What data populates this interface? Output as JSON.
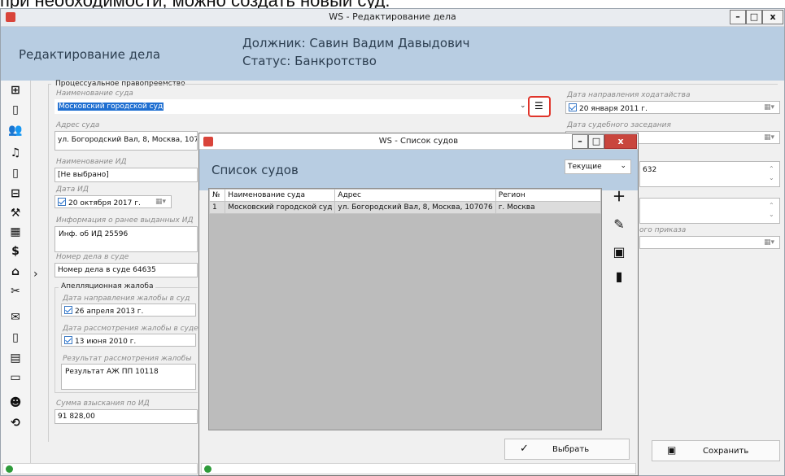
{
  "top_caption": "при необходимости, можно создать новый суд.",
  "main_window": {
    "title": "WS - Редактирование дела",
    "controls": [
      "–",
      "□",
      "x"
    ]
  },
  "header": {
    "section_title": "Редактирование дела",
    "debtor": "Должник: Савин Вадим Давыдович",
    "status": "Статус: Банкротство"
  },
  "sidebar_icons": [
    "add-document-icon",
    "document-icon",
    "users-icon",
    "bell-icon",
    "document-search-icon",
    "archive-icon",
    "gavel-icon",
    "calendar-icon",
    "dollar-icon",
    "house-search-icon",
    "tools-icon",
    "mail-icon",
    "file-refresh-icon",
    "file-text-icon",
    "chat-icon",
    "users-volume-icon",
    "history-icon"
  ],
  "form": {
    "group_title": "Процессуальное правопреемство",
    "court_name_label": "Наименование суда",
    "court_name_value": "Московский городской суд",
    "court_address_label": "Адрес суда",
    "court_address_value": "ул. Богородский Вал, 8, Москва, 107076",
    "id_name_label": "Наименование ИД",
    "id_name_value": "[Не выбрано]",
    "id_date_label": "Дата ИД",
    "id_date_day": "20",
    "id_date_month": "октября",
    "id_date_year": "2017 г.",
    "prev_id_info_label": "Информация о ранее выданных ИД",
    "prev_id_info_value": "Инф. об ИД 25596",
    "court_case_no_label": "Номер дела в суде",
    "court_case_no_value": "Номер дела в суде 64635",
    "appeal_group_title": "Апелляционная жалоба",
    "appeal_sent_label": "Дата направления жалобы в суд",
    "appeal_sent_day": "26",
    "appeal_sent_month": "апреля",
    "appeal_sent_year": "2013 г.",
    "appeal_review_label": "Дата рассмотрения жалобы в суде",
    "appeal_review_day": "13",
    "appeal_review_month": "июня",
    "appeal_review_year": "2010 г.",
    "appeal_result_label": "Результат рассмотрения жалобы",
    "appeal_result_value": "Результат АЖ ПП 10118",
    "amount_label": "Сумма взыскания по ИД",
    "amount_value": "91 828,00",
    "petition_date_label": "Дата направления ходатайства",
    "petition_day": "20",
    "petition_month": "января",
    "petition_year": "2011 г.",
    "hearing_date_label": "Дата судебного заседания",
    "right_field_partial": "632",
    "right_label_partial": "ого приказа",
    "save_button": "Сохранить"
  },
  "dialog": {
    "title": "WS - Список судов",
    "header_title": "Список судов",
    "filter_value": "Текущие",
    "table": {
      "columns": [
        "№",
        "Наименование суда",
        "Адрес",
        "Регион"
      ],
      "rows": [
        [
          "1",
          "Московский городской суд",
          "ул. Богородский Вал, 8, Москва, 107076",
          "г. Москва"
        ]
      ]
    },
    "select_button": "Выбрать"
  }
}
